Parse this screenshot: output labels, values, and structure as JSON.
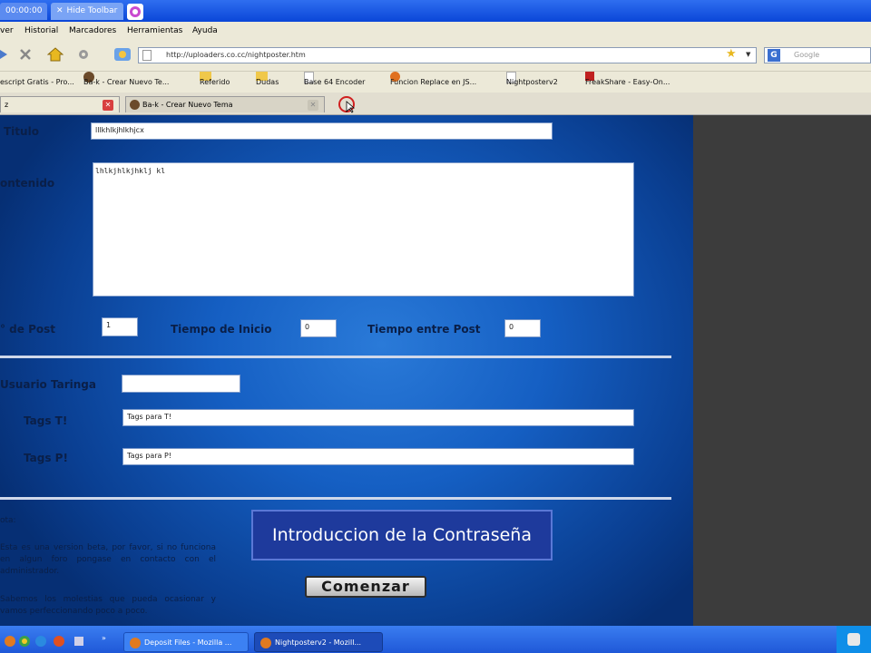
{
  "browser": {
    "title_tabs": [
      {
        "label": "00:00:00"
      },
      {
        "label": "Hide Toolbar"
      }
    ],
    "menu": [
      "ver",
      "Historial",
      "Marcadores",
      "Herramientas",
      "Ayuda"
    ],
    "url": "http://uploaders.co.cc/nightposter.htm",
    "search_placeholder": "Google",
    "bookmarks": [
      "escript Gratis - Pro...",
      "Ba-k - Crear Nuevo Te...",
      "Referido",
      "Dudas",
      "Base 64 Encoder",
      "Funcion Replace en JS...",
      "Nightposterv2",
      "FreakShare - Easy-On..."
    ],
    "tabs": [
      {
        "label": "z"
      },
      {
        "label": "Ba-k - Crear Nuevo Tema"
      }
    ]
  },
  "form": {
    "titulo_label": "Titulo",
    "titulo_value": "lllkhlkjhlkhjcx",
    "contenido_label": "ontenido",
    "contenido_value": "lhlkjhlkjhklj kl",
    "npost_label": "° de Post",
    "npost_value": "1",
    "inicio_label": "Tiempo de Inicio",
    "inicio_value": "0",
    "entre_label": "Tiempo entre Post",
    "entre_value": "0",
    "usuario_label": "Usuario Taringa",
    "usuario_value": "",
    "tagst_label": "Tags T!",
    "tagst_value": "Tags para T!",
    "tagsp_label": "Tags P!",
    "tagsp_value": "Tags para P!",
    "note_title": "ota:",
    "note_p1": "Esta es una version beta, por favor, si no funciona en algun foro pongase en contacto con el administrador.",
    "note_p2": "Sabemos los molestias que pueda ocasionar y vamos perfeccionando poco a poco.",
    "password_label": "Introduccion de la Contraseña",
    "start_label": "Comenzar"
  },
  "taskbar": {
    "tasks": [
      {
        "label": "Deposit Files - Mozilla ..."
      },
      {
        "label": "Nightposterv2 - Mozill..."
      }
    ]
  },
  "colors": {
    "accent": "#155fc3",
    "titlebar": "#0a46d8",
    "taskbar": "#1f58d8"
  }
}
